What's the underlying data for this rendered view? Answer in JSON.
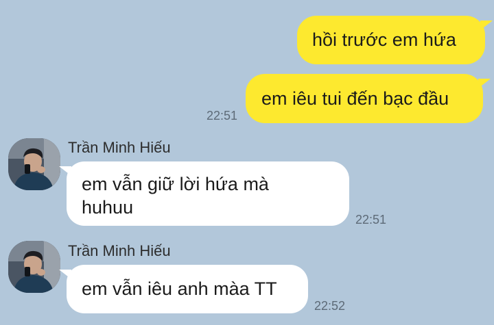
{
  "messages": [
    {
      "direction": "outgoing",
      "text": "hồi trước em hứa"
    },
    {
      "direction": "outgoing",
      "text": "em iêu tui đến bạc đầu",
      "time": "22:51"
    },
    {
      "direction": "incoming",
      "sender": "Trần Minh Hiếu",
      "avatar_icon": "profile-photo-avatar",
      "lines": [
        "em vẫn giữ lời hứa mà",
        "huhuu"
      ],
      "time": "22:51"
    },
    {
      "direction": "incoming",
      "sender": "Trần Minh Hiếu",
      "avatar_icon": "profile-photo-avatar",
      "text": "em vẫn iêu anh màa TT",
      "time": "22:52"
    }
  ],
  "colors": {
    "background": "#b2c7da",
    "outgoing_bubble": "#fde92f",
    "incoming_bubble": "#ffffff",
    "timestamp": "#5d6a77"
  }
}
